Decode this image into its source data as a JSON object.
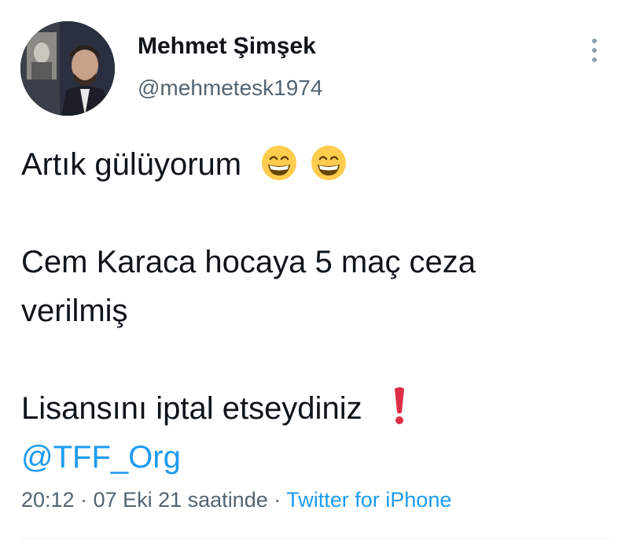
{
  "author": {
    "display_name": "Mehmet Şimşek",
    "handle": "@mehmetesk1974"
  },
  "tweet": {
    "line1": "Artık gülüyorum",
    "line1_emojis": [
      "grinning-face-with-smiling-eyes",
      "grinning-face-with-smiling-eyes"
    ],
    "line2": "Cem Karaca hocaya 5 maç ceza",
    "line3": "verilmiş",
    "line4": "Lisansını iptal etseydiniz",
    "line4_emoji": "red-exclamation-mark",
    "mention": "@TFF_Org"
  },
  "meta": {
    "time": "20:12",
    "separator1": " · ",
    "date": "07 Eki 21 saatinde",
    "separator2": " · ",
    "source": "Twitter for iPhone"
  },
  "icons": {
    "more": "more-vertical-icon"
  },
  "colors": {
    "text": "#0f1419",
    "secondary": "#536471",
    "link": "#1d9bf0",
    "emoji_face": "#ffcc4d",
    "exclamation": "#dd2e44"
  }
}
